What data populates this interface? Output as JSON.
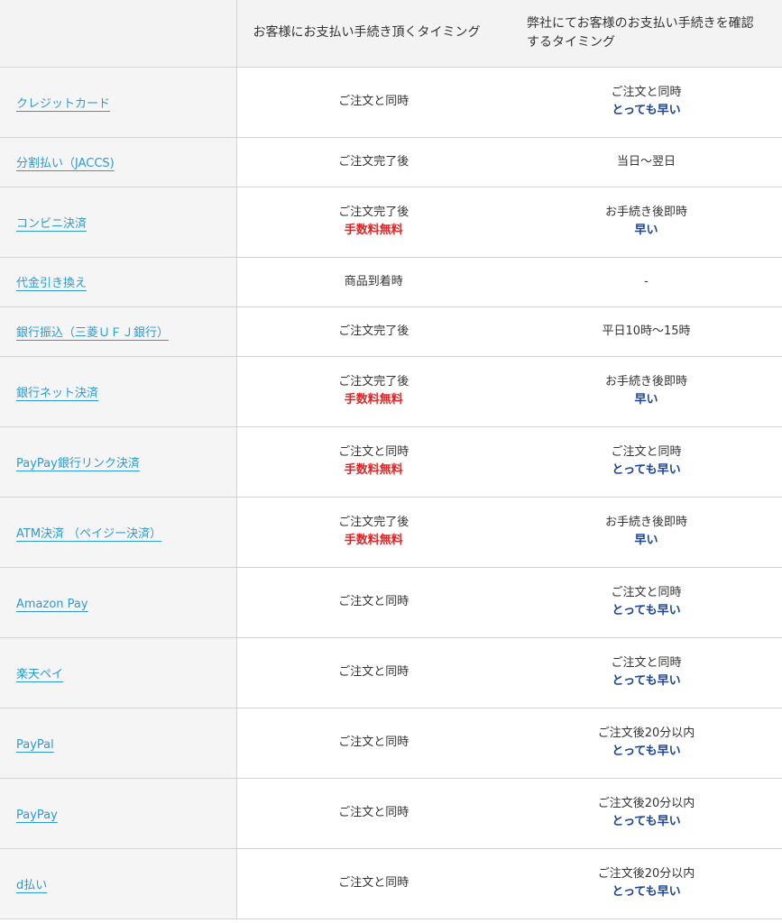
{
  "header": {
    "col2": "お客様にお支払い手続き頂くタイミング",
    "col3_line1": "弊社にてお客様のお支払い手続きを確認",
    "col3_line2": "するタイミング"
  },
  "rows": [
    {
      "method": "クレジットカード",
      "customer": "ご注文と同時",
      "customer_note": "",
      "confirm": "ご注文と同時",
      "confirm_note": "とっても早い"
    },
    {
      "method": "分割払い（JACCS)",
      "customer": "ご注文完了後",
      "customer_note": "",
      "confirm": "当日〜翌日",
      "confirm_note": ""
    },
    {
      "method": "コンビニ決済",
      "customer": "ご注文完了後",
      "customer_note": "手数料無料",
      "confirm": "お手続き後即時",
      "confirm_note": "早い"
    },
    {
      "method": "代金引き換え",
      "customer": "商品到着時",
      "customer_note": "",
      "confirm": "-",
      "confirm_note": ""
    },
    {
      "method": "銀行振込（三菱ＵＦＪ銀行）",
      "customer": "ご注文完了後",
      "customer_note": "",
      "confirm": "平日10時〜15時",
      "confirm_note": ""
    },
    {
      "method": "銀行ネット決済",
      "customer": "ご注文完了後",
      "customer_note": "手数料無料",
      "confirm": "お手続き後即時",
      "confirm_note": "早い"
    },
    {
      "method": "PayPay銀行リンク決済",
      "customer": "ご注文と同時",
      "customer_note": "手数料無料",
      "confirm": "ご注文と同時",
      "confirm_note": "とっても早い"
    },
    {
      "method": "ATM決済 （ペイジー決済）",
      "customer": "ご注文完了後",
      "customer_note": "手数料無料",
      "confirm": "お手続き後即時",
      "confirm_note": "早い"
    },
    {
      "method": "Amazon Pay",
      "customer": "ご注文と同時",
      "customer_note": "",
      "confirm": "ご注文と同時",
      "confirm_note": "とっても早い"
    },
    {
      "method": "楽天ペイ",
      "customer": "ご注文と同時",
      "customer_note": "",
      "confirm": "ご注文と同時",
      "confirm_note": "とっても早い"
    },
    {
      "method": "PayPal",
      "customer": "ご注文と同時",
      "customer_note": "",
      "confirm": "ご注文後20分以内",
      "confirm_note": "とっても早い"
    },
    {
      "method": "PayPay",
      "customer": "ご注文と同時",
      "customer_note": "",
      "confirm": "ご注文後20分以内",
      "confirm_note": "とっても早い"
    },
    {
      "method": "d払い",
      "customer": "ご注文と同時",
      "customer_note": "",
      "confirm": "ご注文後20分以内",
      "confirm_note": "とっても早い"
    }
  ],
  "colors": {
    "link": "#2b9bd6",
    "fee": "#e02424",
    "fast": "#1c4595",
    "header_bg": "#f3f3f3"
  }
}
